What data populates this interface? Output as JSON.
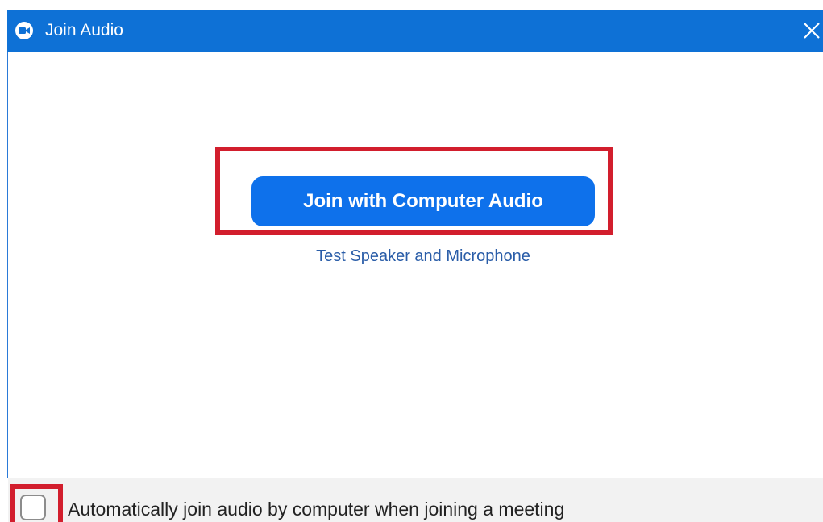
{
  "window": {
    "title": "Join Audio",
    "titlebar_color": "#0e71d6",
    "app_icon": "zoom-camera-icon",
    "close_icon": "close-icon"
  },
  "main": {
    "join_button_label": "Join with Computer Audio",
    "join_button_color": "#0e71eb",
    "test_link_label": "Test Speaker and Microphone",
    "test_link_color": "#2a5da8"
  },
  "footer": {
    "auto_join_label": "Automatically join audio by computer when joining a meeting",
    "auto_join_checked": false
  },
  "annotations": {
    "highlight_color": "#d21e2d"
  }
}
